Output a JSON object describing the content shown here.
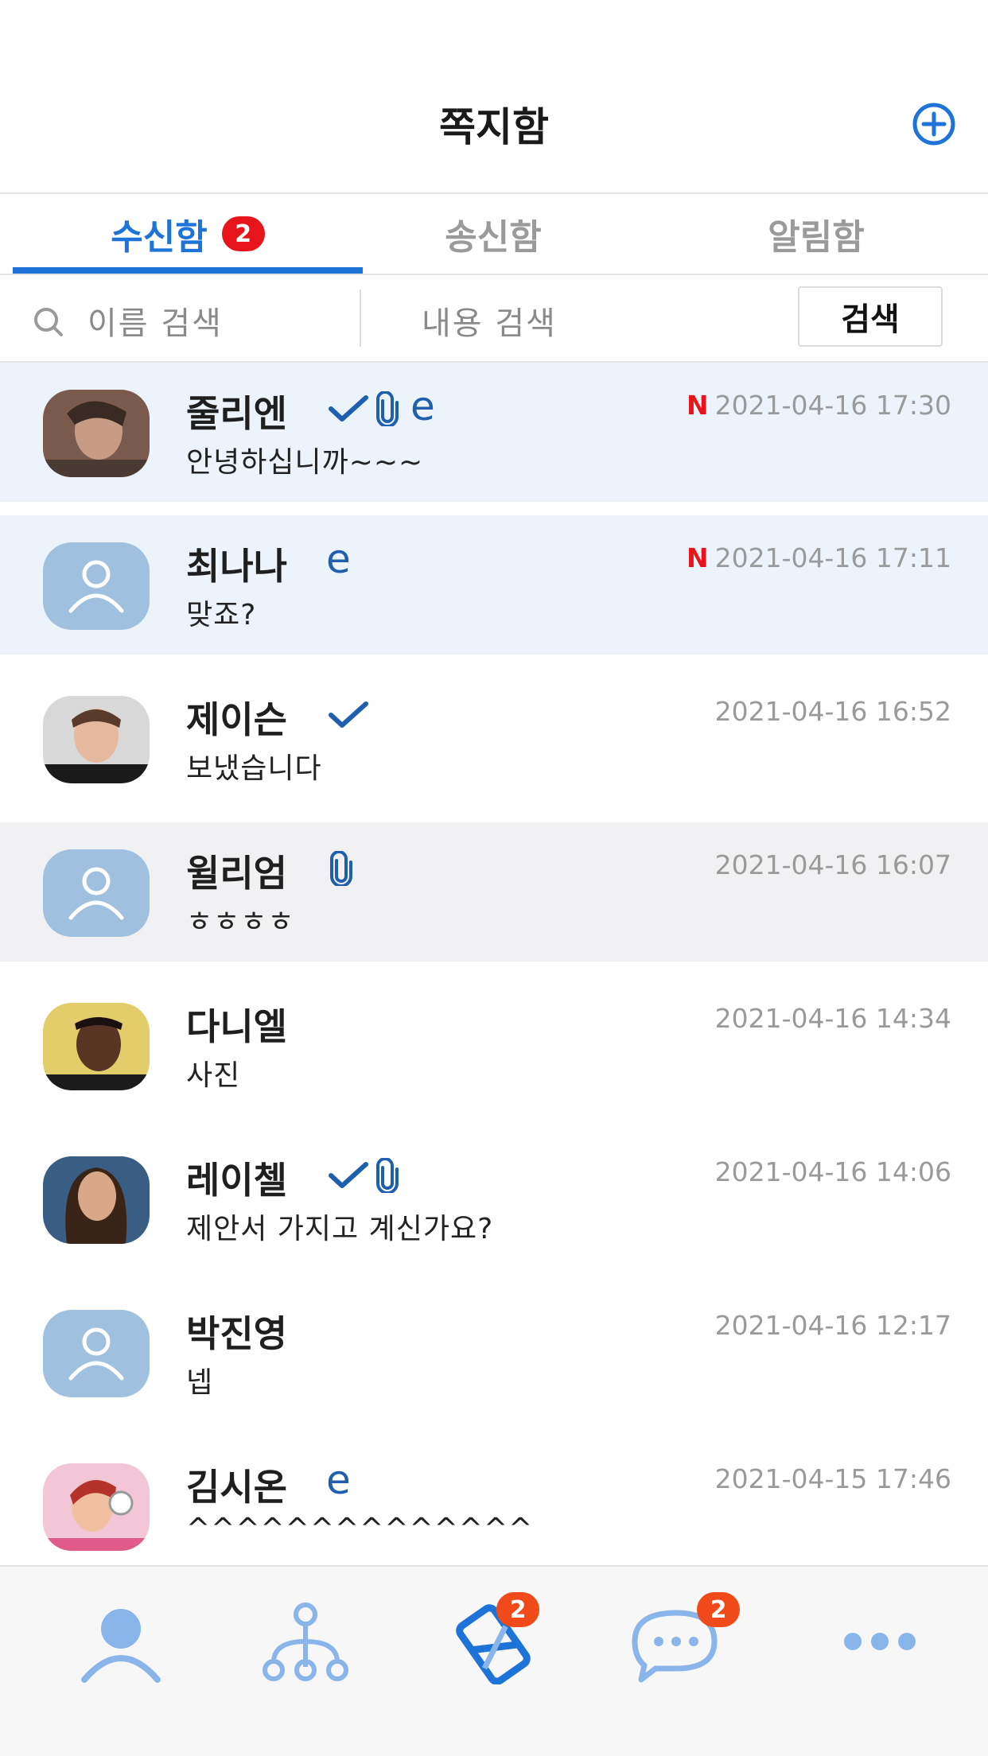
{
  "header": {
    "title": "쪽지함",
    "add_icon": "plus-circle-icon"
  },
  "tabs": [
    {
      "label": "수신함",
      "badge": "2",
      "active": true
    },
    {
      "label": "송신함",
      "active": false
    },
    {
      "label": "알림함",
      "active": false
    }
  ],
  "search": {
    "name_placeholder": "이름 검색",
    "content_placeholder": "내용 검색",
    "button_label": "검색"
  },
  "messages": [
    {
      "name": "줄리엔",
      "preview": "안녕하십니까~~~",
      "datetime": "2021-04-16 17:30",
      "new": "N",
      "read_check": true,
      "attachment": true,
      "email": "e",
      "unread": true
    },
    {
      "name": "최나나",
      "preview": "맞죠?",
      "datetime": "2021-04-16 17:11",
      "new": "N",
      "read_check": false,
      "attachment": false,
      "email": "e",
      "unread": true
    },
    {
      "name": "제이슨",
      "preview": "보냈습니다",
      "datetime": "2021-04-16 16:52",
      "read_check": true,
      "attachment": false
    },
    {
      "name": "윌리엄",
      "preview": "ㅎㅎㅎㅎ",
      "datetime": "2021-04-16 16:07",
      "read_check": false,
      "attachment": true,
      "selected": true
    },
    {
      "name": "다니엘",
      "preview": "사진",
      "datetime": "2021-04-16 14:34"
    },
    {
      "name": "레이첼",
      "preview": "제안서 가지고 계신가요?",
      "datetime": "2021-04-16 14:06",
      "read_check": true,
      "attachment": true
    },
    {
      "name": "박진영",
      "preview": "넵",
      "datetime": "2021-04-16 12:17"
    },
    {
      "name": "김시온",
      "preview": "^^^^^^^^^^^^^^",
      "datetime": "2021-04-15 17:46",
      "email": "e"
    }
  ],
  "bottom_nav": [
    {
      "icon": "person-icon"
    },
    {
      "icon": "org-chart-icon"
    },
    {
      "icon": "note-icon",
      "badge": "2",
      "active": true
    },
    {
      "icon": "chat-bubble-icon",
      "badge": "2"
    },
    {
      "icon": "more-icon"
    }
  ],
  "colors": {
    "accent": "#1e73d8",
    "badge_red": "#e8141c",
    "badge_orange": "#f04a1a",
    "unread_bg": "#ecf3fb",
    "icon_blue": "#1f5fae",
    "nav_icon": "#8ab5ea"
  }
}
